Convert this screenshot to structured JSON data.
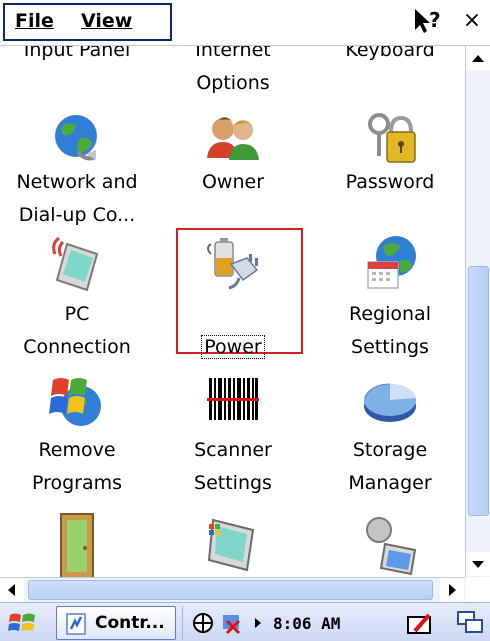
{
  "menubar": {
    "file_label": "File",
    "file_mnemonic": "F",
    "view_label": "View",
    "view_mnemonic": "V",
    "help_icon": "help-question-icon",
    "close_label": "×"
  },
  "control_panel": {
    "partial_top": [
      {
        "label": "Input Panel"
      },
      {
        "label": "Internet\nOptions"
      },
      {
        "label": "Keyboard"
      }
    ],
    "items": [
      {
        "label": "Network and\nDial-up Co...",
        "icon": "network-globe-icon"
      },
      {
        "label": "Owner",
        "icon": "owner-users-icon"
      },
      {
        "label": "Password",
        "icon": "password-keys-lock-icon"
      },
      {
        "label": "PC\nConnection",
        "icon": "pc-connection-device-icon"
      },
      {
        "label": "Power",
        "icon": "power-battery-plug-icon",
        "selected": true
      },
      {
        "label": "Regional\nSettings",
        "icon": "regional-globe-calendar-icon"
      },
      {
        "label": "Remove\nPrograms",
        "icon": "windows-logo-globe-icon"
      },
      {
        "label": "Scanner\nSettings",
        "icon": "barcode-scanner-icon"
      },
      {
        "label": "Storage\nManager",
        "icon": "storage-pie-chart-icon"
      },
      {
        "label": "",
        "icon": "door-icon"
      },
      {
        "label": "",
        "icon": "display-monitor-icon"
      },
      {
        "label": "",
        "icon": "system-computer-icon"
      }
    ]
  },
  "taskbar": {
    "task_label": "Contr...",
    "clock": "8:06 AM"
  },
  "colors": {
    "selection_border": "#d32020",
    "scroll_track": "#eef2fb",
    "scroll_thumb": "#b6cdf6",
    "taskbar": "#cdd9f3"
  }
}
